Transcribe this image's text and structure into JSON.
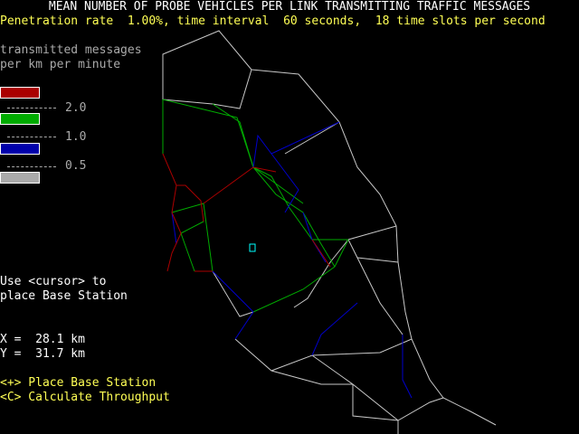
{
  "header": {
    "title": "MEAN NUMBER OF PROBE VEHICLES PER LINK TRANSMITTING TRAFFIC MESSAGES",
    "subtitle": "Penetration rate  1.00%, time interval  60 seconds,  18 time slots per second"
  },
  "legend": {
    "title_line1": "transmitted messages",
    "title_line2": "per km per minute",
    "ticks": [
      "2.0",
      "1.0",
      "0.5"
    ],
    "colors": {
      "high": "#aa0000",
      "medium": "#00aa00",
      "low": "#0000aa",
      "minimal": "#aaaaaa"
    }
  },
  "instructions": {
    "line1": "Use <cursor> to",
    "line2": "place Base Station"
  },
  "cursor": {
    "x_text": "X =  28.1 km",
    "y_text": "Y =  31.7 km",
    "color": "#00ffff"
  },
  "keys": {
    "place": "<+> Place Base Station",
    "calculate": "<C> Calculate Throughput"
  },
  "network_colors": {
    "road": "#c8c8c8",
    "red": "#aa0000",
    "green": "#00aa00",
    "blue": "#0000cc"
  }
}
